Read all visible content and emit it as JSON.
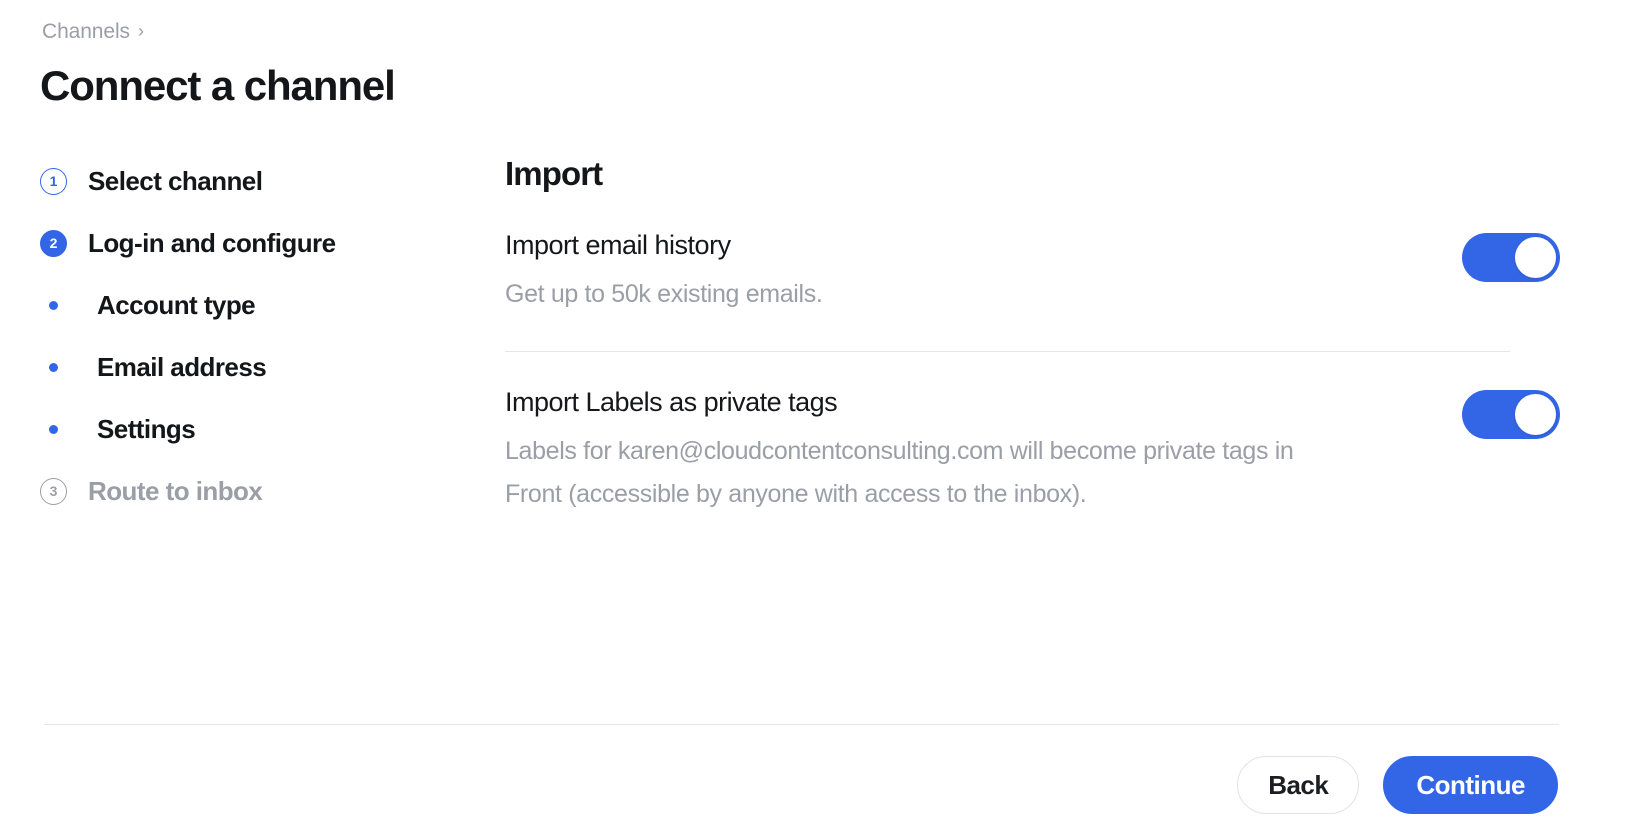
{
  "header": {
    "breadcrumb": "Channels",
    "breadcrumb_chevron": "›",
    "title": "Connect a channel"
  },
  "stepper": {
    "steps": [
      {
        "marker": "1",
        "marker_style": "circle-outline-blue",
        "label": "Select channel",
        "state": "available"
      },
      {
        "marker": "2",
        "marker_style": "circle-filled-blue",
        "label": "Log-in and configure",
        "state": "active"
      },
      {
        "marker": "bullet",
        "marker_style": "bullet",
        "label": "Account type",
        "state": "substep"
      },
      {
        "marker": "bullet",
        "marker_style": "bullet",
        "label": "Email address",
        "state": "substep"
      },
      {
        "marker": "bullet",
        "marker_style": "bullet",
        "label": "Settings",
        "state": "substep"
      },
      {
        "marker": "3",
        "marker_style": "circle-outline-gray",
        "label": "Route to inbox",
        "state": "disabled"
      }
    ]
  },
  "main": {
    "section_title": "Import",
    "settings": [
      {
        "name": "Import email history",
        "description": "Get up to 50k existing emails.",
        "toggle_on": true
      },
      {
        "name": "Import Labels as private tags",
        "description": "Labels for karen@cloudcontentconsulting.com will become private tags in Front (accessible by anyone with access to the inbox).",
        "toggle_on": true
      }
    ]
  },
  "footer": {
    "back_label": "Back",
    "continue_label": "Continue"
  },
  "colors": {
    "accent_blue": "#3366e6",
    "text_primary": "#15161a",
    "text_muted": "#9a9ea6",
    "divider": "#e4e6ea"
  }
}
